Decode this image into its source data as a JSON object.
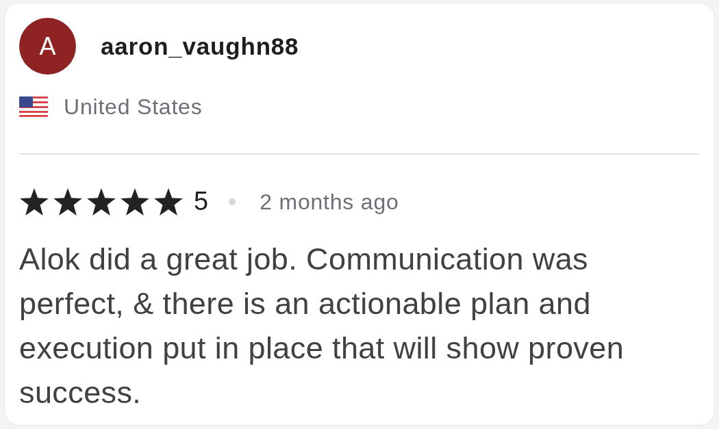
{
  "reviewer": {
    "initial": "A",
    "username": "aaron_vaughn88",
    "country": "United States"
  },
  "review": {
    "stars": 5,
    "rating": "5",
    "time": "2 months ago",
    "text": "Alok did a great job. Communication was perfect, & there is an actionable plan and execution put in place that will show proven success."
  }
}
